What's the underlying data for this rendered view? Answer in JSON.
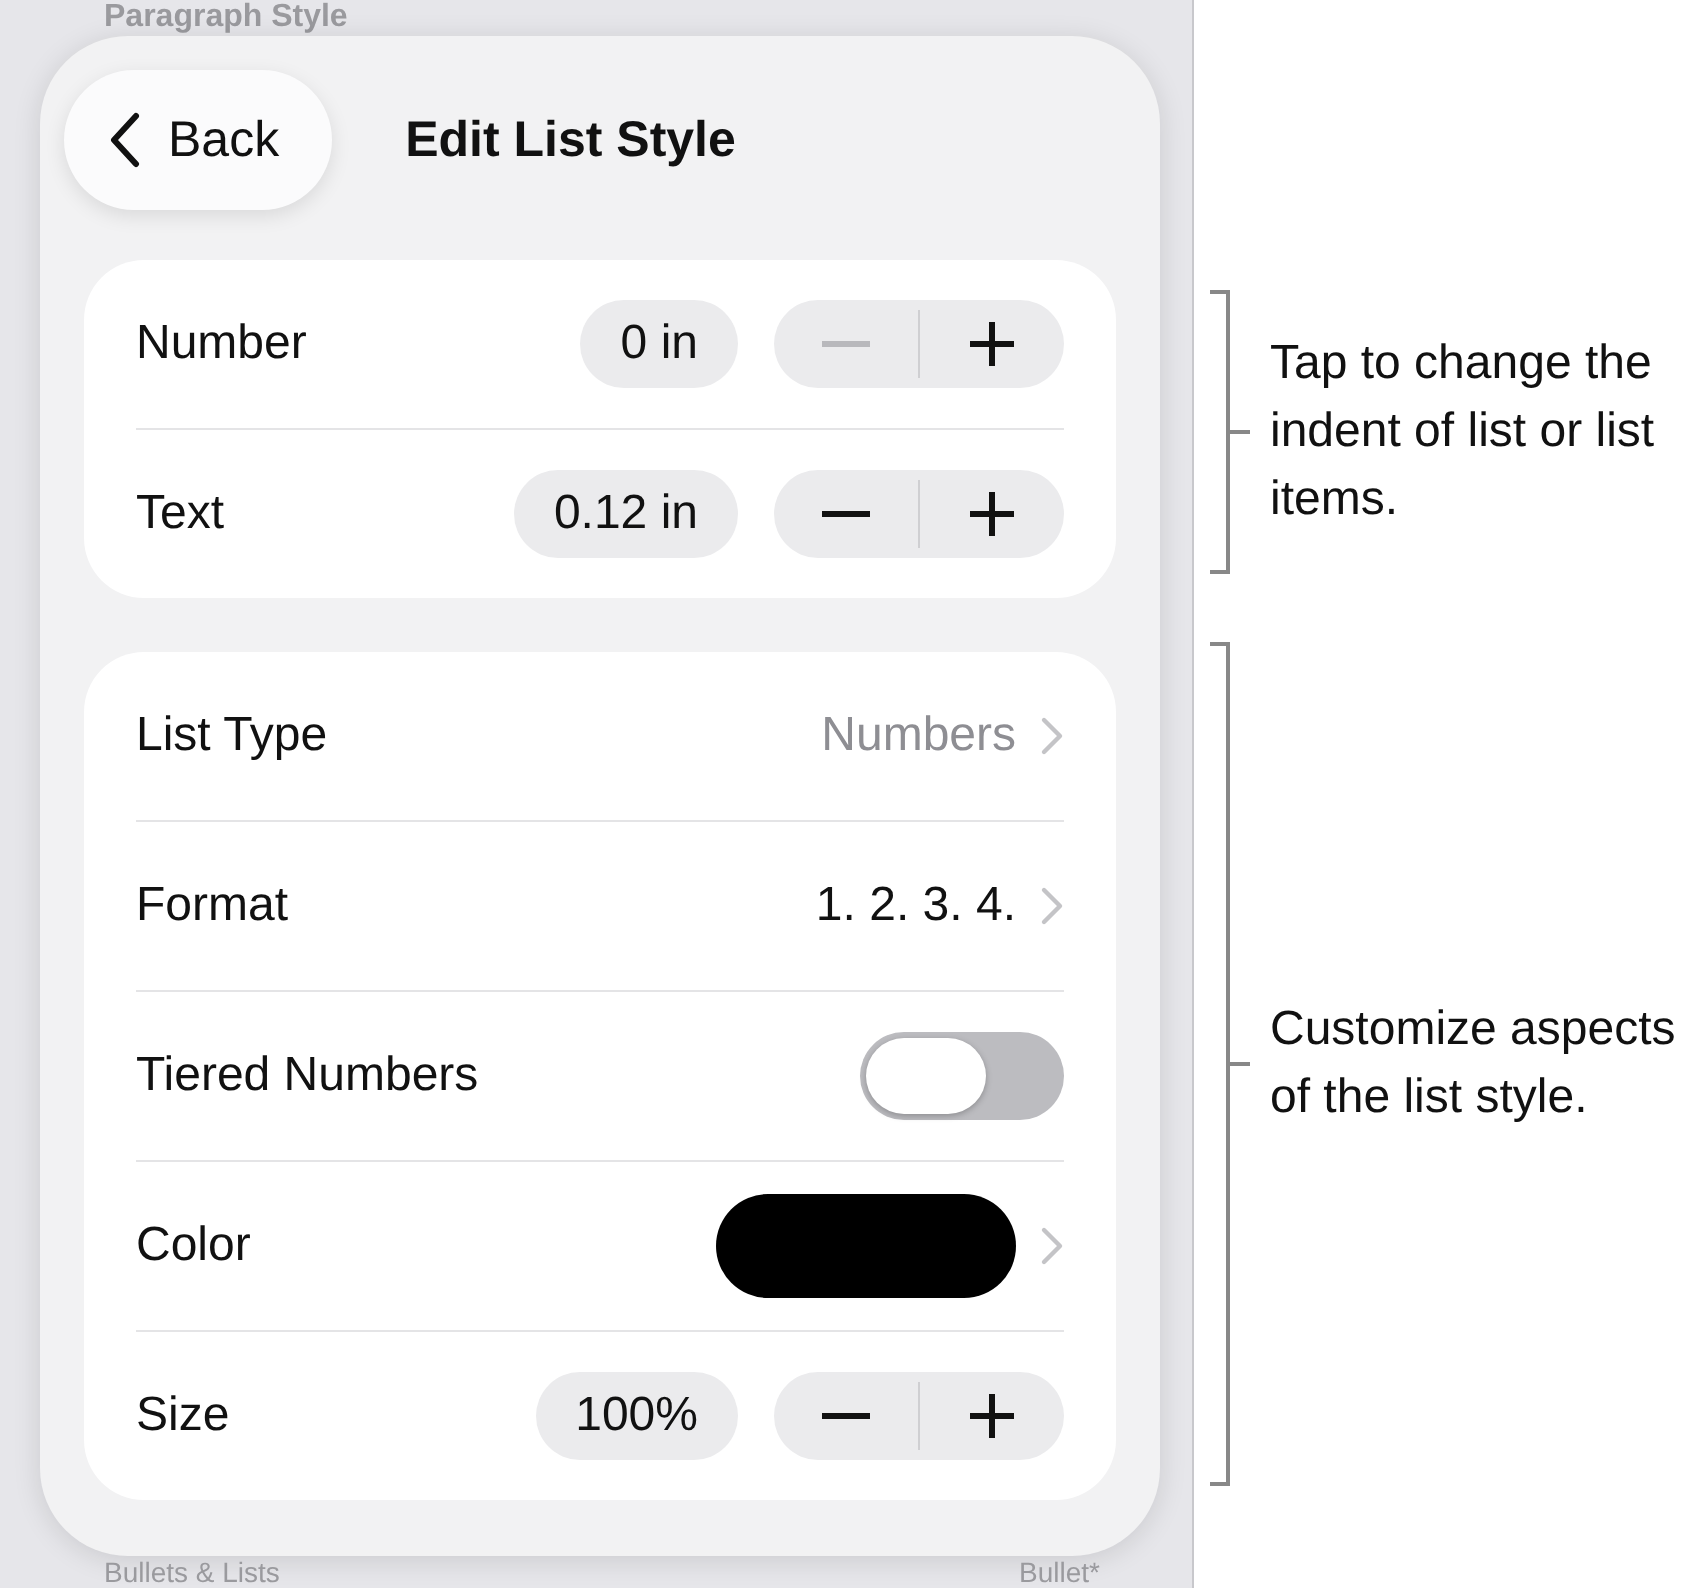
{
  "background": {
    "top_item": "Paragraph Style",
    "bottom_item": "Bullets & Lists",
    "bottom_value": "Bullet*"
  },
  "header": {
    "back": "Back",
    "title": "Edit List Style"
  },
  "indents": [
    {
      "label": "Number",
      "value": "0 in",
      "decrement_disabled": true,
      "increment_disabled": false
    },
    {
      "label": "Text",
      "value": "0.12 in",
      "decrement_disabled": false,
      "increment_disabled": false
    }
  ],
  "settings": [
    {
      "kind": "link",
      "label": "List Type",
      "value": "Numbers",
      "muted": true
    },
    {
      "kind": "link",
      "label": "Format",
      "value": "1. 2. 3. 4.",
      "muted": false
    },
    {
      "kind": "toggle",
      "label": "Tiered Numbers",
      "on": false
    },
    {
      "kind": "color",
      "label": "Color",
      "color": "#000000"
    },
    {
      "kind": "stepper",
      "label": "Size",
      "value": "100%",
      "decrement_disabled": false,
      "increment_disabled": false
    }
  ],
  "annotations": [
    {
      "text": "Tap to change the indent of list or list items."
    },
    {
      "text": "Customize aspects of the list style."
    }
  ]
}
